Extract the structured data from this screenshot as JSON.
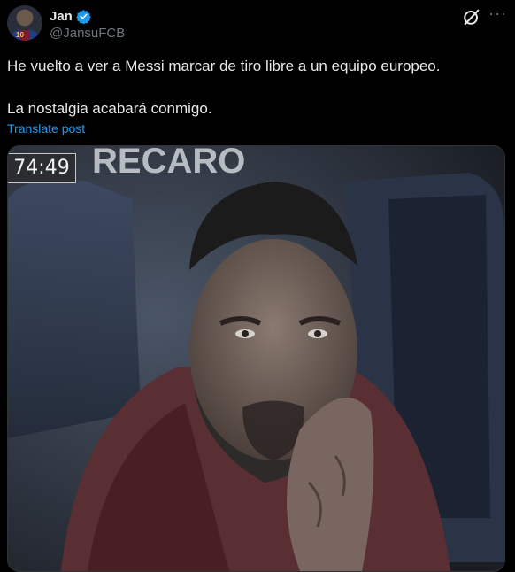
{
  "author": {
    "name": "Jan",
    "handle": "@JansuFCB",
    "verified": true,
    "avatar_icon": "profile-avatar"
  },
  "post": {
    "line1": "He vuelto a ver a Messi marcar de tiro libre a un equipo europeo.",
    "line2": "La nostalgia acabará conmigo.",
    "translate_label": "Translate post"
  },
  "media": {
    "scoreboard_time": "74:49",
    "banner_text": "RECARO"
  },
  "colors": {
    "background": "#000000",
    "text": "#e7e9ea",
    "secondary": "#71767b",
    "link": "#1d9bf0",
    "verified": "#1d9bf0"
  }
}
